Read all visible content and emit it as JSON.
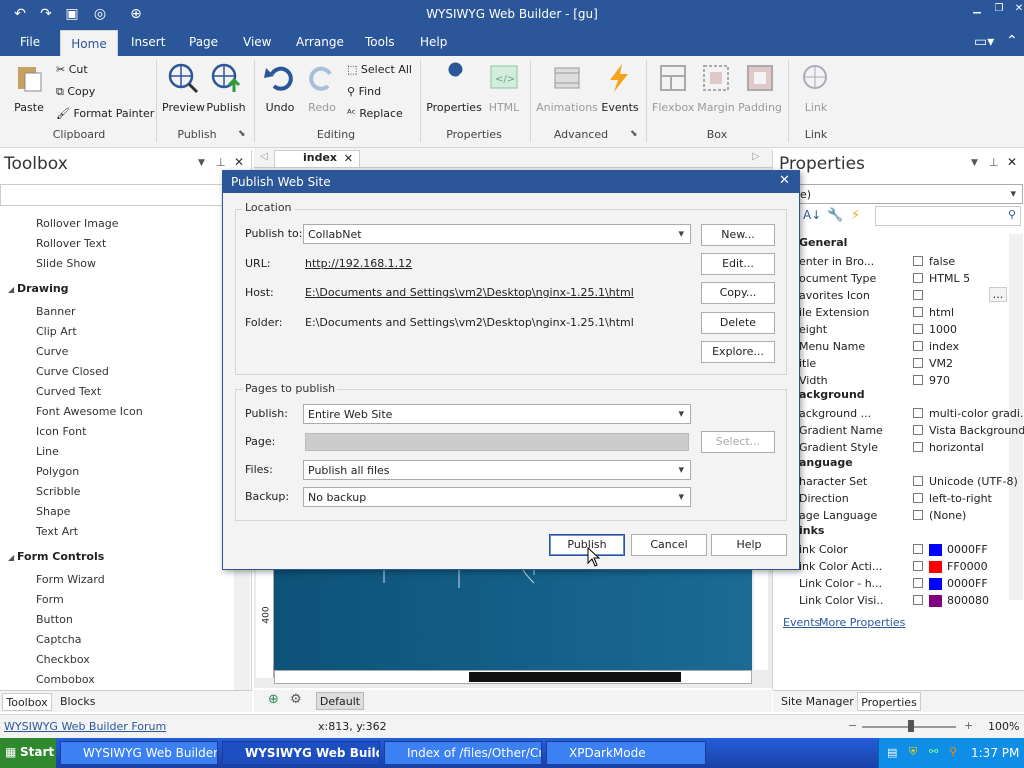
{
  "window": {
    "title": "WYSIWYG Web Builder - [gu]"
  },
  "menu": [
    "File",
    "Home",
    "Insert",
    "Page",
    "View",
    "Arrange",
    "Tools",
    "Help"
  ],
  "ribbon": {
    "paste": "Paste",
    "cut": "Cut",
    "copy": "Copy",
    "format_painter": "Format Painter",
    "clipboard": "Clipboard",
    "preview": "Preview",
    "publish": "Publish",
    "publish_group": "Publish",
    "undo": "Undo",
    "redo": "Redo",
    "select_all": "Select All",
    "find": "Find",
    "replace": "Replace",
    "editing": "Editing",
    "properties": "Properties",
    "html": "HTML",
    "properties_group": "Properties",
    "animations": "Animations",
    "events": "Events",
    "advanced": "Advanced",
    "flexbox": "Flexbox",
    "margin": "Margin",
    "padding": "Padding",
    "box": "Box",
    "link": "Link",
    "link_group": "Link"
  },
  "toolbox": {
    "title": "Toolbox",
    "items_top": [
      "Rollover Image",
      "Rollover Text",
      "Slide Show"
    ],
    "drawing": "Drawing",
    "drawing_items": [
      "Banner",
      "Clip Art",
      "Curve",
      "Curve Closed",
      "Curved Text",
      "Font Awesome Icon",
      "Icon Font",
      "Line",
      "Polygon",
      "Scribble",
      "Shape",
      "Text Art"
    ],
    "form_controls": "Form Controls",
    "form_items": [
      "Form Wizard",
      "Form",
      "Button",
      "Captcha",
      "Checkbox",
      "Combobox"
    ],
    "tabs": [
      "Toolbox",
      "Blocks"
    ]
  },
  "document": {
    "tab": "index",
    "ruler_label": "400",
    "default_tab": "Default"
  },
  "properties": {
    "title": "Properties",
    "selector": "e)",
    "general": "General",
    "rows": [
      {
        "k": "enter in Bro...",
        "v": "false"
      },
      {
        "k": "ocument Type",
        "v": "HTML 5"
      },
      {
        "k": "avorites Icon",
        "v": ""
      },
      {
        "k": "ile Extension",
        "v": "html"
      },
      {
        "k": "eight",
        "v": "1000"
      },
      {
        "k": "Menu Name",
        "v": "index"
      },
      {
        "k": "itle",
        "v": "VM2"
      },
      {
        "k": "Vidth",
        "v": "970"
      }
    ],
    "background": "ackground",
    "bg_rows": [
      {
        "k": "ackground ...",
        "v": "multi-color gradi..."
      },
      {
        "k": "Gradient Name",
        "v": "Vista Background"
      },
      {
        "k": "Gradient Style",
        "v": "horizontal"
      }
    ],
    "language": "anguage",
    "lang_rows": [
      {
        "k": "haracter Set",
        "v": "Unicode (UTF-8)"
      },
      {
        "k": "Direction",
        "v": "left-to-right"
      },
      {
        "k": "age Language",
        "v": "(None)"
      }
    ],
    "links": "inks",
    "link_rows": [
      {
        "k": "ink Color",
        "v": "0000FF",
        "c": "#0000ff"
      },
      {
        "k": "ink Color Acti...",
        "v": "FF0000",
        "c": "#ff0000"
      },
      {
        "k": "Link Color - h...",
        "v": "0000FF",
        "c": "#0000ff"
      },
      {
        "k": "Link Color Visi...",
        "v": "800080",
        "c": "#800080"
      }
    ],
    "events": "Events",
    "more_properties": "More Properties",
    "tabs": [
      "Site Manager",
      "Properties"
    ]
  },
  "dialog": {
    "title": "Publish Web Site",
    "location": "Location",
    "publish_to_label": "Publish to:",
    "publish_to": "CollabNet",
    "url_label": "URL:",
    "url": "http://192.168.1.12",
    "host_label": "Host:",
    "host": "E:\\Documents and Settings\\vm2\\Desktop\\nginx-1.25.1\\html",
    "folder_label": "Folder:",
    "folder": "E:\\Documents and Settings\\vm2\\Desktop\\nginx-1.25.1\\html",
    "new": "New...",
    "edit": "Edit...",
    "copy": "Copy...",
    "delete": "Delete",
    "explore": "Explore...",
    "pages": "Pages to publish",
    "publish_label": "Publish:",
    "publish_value": "Entire Web Site",
    "page_label": "Page:",
    "select": "Select...",
    "files_label": "Files:",
    "files_value": "Publish all files",
    "backup_label": "Backup:",
    "backup_value": "No backup",
    "ok": "Publish",
    "cancel": "Cancel",
    "help": "Help"
  },
  "status": {
    "forum": "WYSIWYG Web Builder Forum",
    "coords": "x:813, y:362",
    "zoom": "100%"
  },
  "taskbar": {
    "start": "Start",
    "tasks": [
      "WYSIWYG Web Builder - ...",
      "WYSIWYG Web Builde...",
      "Index of /files/Other/Cru...",
      "XPDarkMode"
    ],
    "clock": "1:37 PM"
  }
}
